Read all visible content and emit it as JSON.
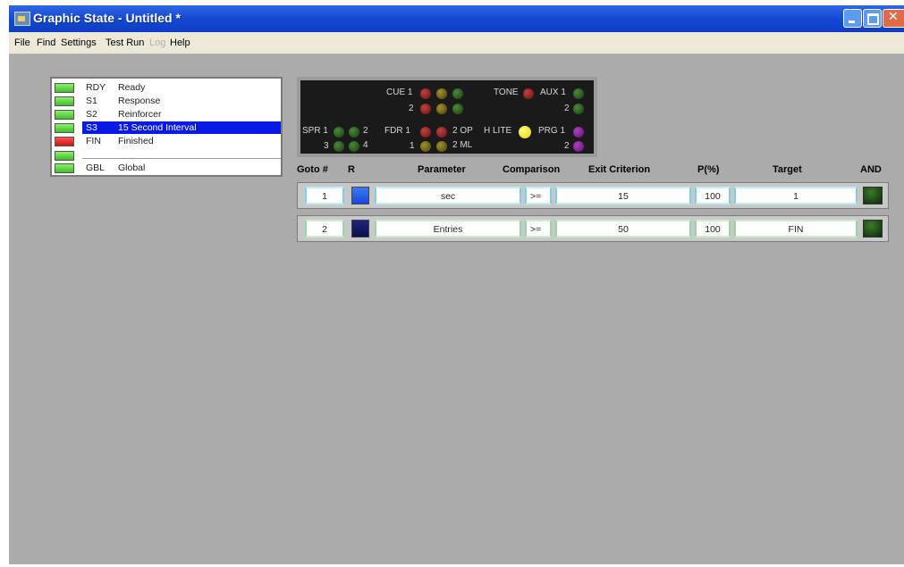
{
  "window": {
    "title": "Graphic State - Untitled *",
    "colors": {
      "titlebar": "#1547d2",
      "background": "#ababab"
    }
  },
  "menu": {
    "items": [
      {
        "label": "File",
        "enabled": true
      },
      {
        "label": "Find",
        "enabled": true
      },
      {
        "label": "Settings",
        "enabled": true
      },
      {
        "label": "Test Run",
        "enabled": true
      },
      {
        "label": "Log",
        "enabled": false
      },
      {
        "label": "Help",
        "enabled": true
      }
    ]
  },
  "states": [
    {
      "code": "RDY",
      "name": "Ready",
      "led": "green",
      "selected": false
    },
    {
      "code": "S1",
      "name": "Response",
      "led": "green",
      "selected": false
    },
    {
      "code": "S2",
      "name": "Reinforcer",
      "led": "green",
      "selected": false
    },
    {
      "code": "S3",
      "name": "15 Second Interval",
      "led": "green",
      "selected": true
    },
    {
      "code": "FIN",
      "name": "Finished",
      "led": "red",
      "selected": false
    },
    {
      "code": "",
      "name": "",
      "led": "green",
      "selected": false
    },
    {
      "code": "GBL",
      "name": "Global",
      "led": "green",
      "selected": false
    }
  ],
  "io_panel": {
    "cue1": "CUE 1",
    "cue2": "2",
    "tone": "TONE",
    "aux1": "AUX 1",
    "aux2": "2",
    "spr1": "SPR 1",
    "spr2": "2",
    "spr3": "3",
    "spr4": "4",
    "fdr1": "FDR 1",
    "op2": "2 OP",
    "fdr2": "1",
    "ml2": "2 ML",
    "hlite": "H LITE",
    "prg1": "PRG 1",
    "prg2": "2"
  },
  "criteria": {
    "headers": {
      "goto": "Goto #",
      "r": "R",
      "parameter": "Parameter",
      "comparison": "Comparison",
      "exit": "Exit Criterion",
      "p": "P(%)",
      "target": "Target",
      "and": "AND"
    },
    "rows": [
      {
        "goto": "1",
        "parameter": "sec",
        "comparison": ">=",
        "exit": "15",
        "p": "100",
        "target": "1",
        "r_color": "#2060e8"
      },
      {
        "goto": "2",
        "parameter": "Entries",
        "comparison": ">=",
        "exit": "50",
        "p": "100",
        "target": "FIN",
        "r_color": "#101860"
      }
    ]
  }
}
